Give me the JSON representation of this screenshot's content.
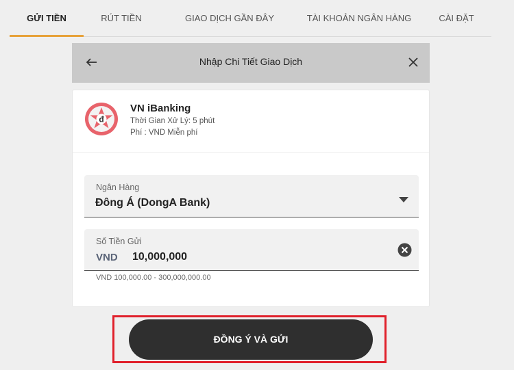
{
  "tabs": [
    {
      "label": "GỬI TIỀN",
      "active": true
    },
    {
      "label": "RÚT TIỀN",
      "active": false
    },
    {
      "label": "GIAO DỊCH GẦN ĐÂY",
      "active": false
    },
    {
      "label": "TÀI KHOẢN NGÂN HÀNG",
      "active": false
    },
    {
      "label": "CÀI ĐẶT",
      "active": false
    }
  ],
  "modal": {
    "title": "Nhập Chi Tiết Giao Dịch",
    "back_icon": "arrow-left-icon",
    "close_icon": "close-icon"
  },
  "method": {
    "logo_glyph": "đ",
    "name": "VN iBanking",
    "processing_time": "Thời Gian Xử Lý: 5 phút",
    "fee": "Phí : VND Miễn phí"
  },
  "bank_field": {
    "label": "Ngân Hàng",
    "value": "Đông Á (DongA Bank)"
  },
  "amount_field": {
    "label": "Số Tiền Gửi",
    "currency": "VND",
    "value": "10,000,000",
    "hint": "VND 100,000.00 - 300,000,000.00"
  },
  "submit": {
    "label": "ĐỒNG Ý VÀ GỬI"
  },
  "colors": {
    "accent": "#e7a23a",
    "highlight": "#e0202b",
    "button": "#2f2f2f",
    "header": "#c9c9c9"
  }
}
